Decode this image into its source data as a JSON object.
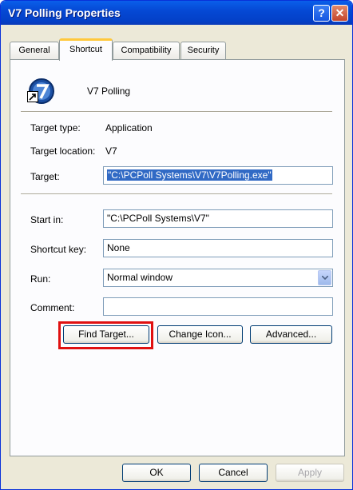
{
  "window": {
    "title": "V7 Polling Properties"
  },
  "titlebar_buttons": {
    "help": "?",
    "close": "✕"
  },
  "tabs": [
    {
      "label": "General"
    },
    {
      "label": "Shortcut"
    },
    {
      "label": "Compatibility"
    },
    {
      "label": "Security"
    }
  ],
  "header": {
    "name": "V7 Polling"
  },
  "target_type": {
    "label": "Target type:",
    "value": "Application"
  },
  "target_location": {
    "label": "Target location:",
    "value": "V7"
  },
  "target": {
    "label": "Target:",
    "value": "\"C:\\PCPoll Systems\\V7\\V7Polling.exe\""
  },
  "start_in": {
    "label": "Start in:",
    "value": "\"C:\\PCPoll Systems\\V7\""
  },
  "shortcut_key": {
    "label": "Shortcut key:",
    "value": "None"
  },
  "run": {
    "label": "Run:",
    "value": "Normal window"
  },
  "comment": {
    "label": "Comment:",
    "value": ""
  },
  "buttons": {
    "find_target": "Find Target...",
    "change_icon": "Change Icon...",
    "advanced": "Advanced...",
    "ok": "OK",
    "cancel": "Cancel",
    "apply": "Apply"
  },
  "colors": {
    "titlebar": "#0549D5",
    "highlight_box": "#E01010",
    "selection": "#316AC5"
  }
}
